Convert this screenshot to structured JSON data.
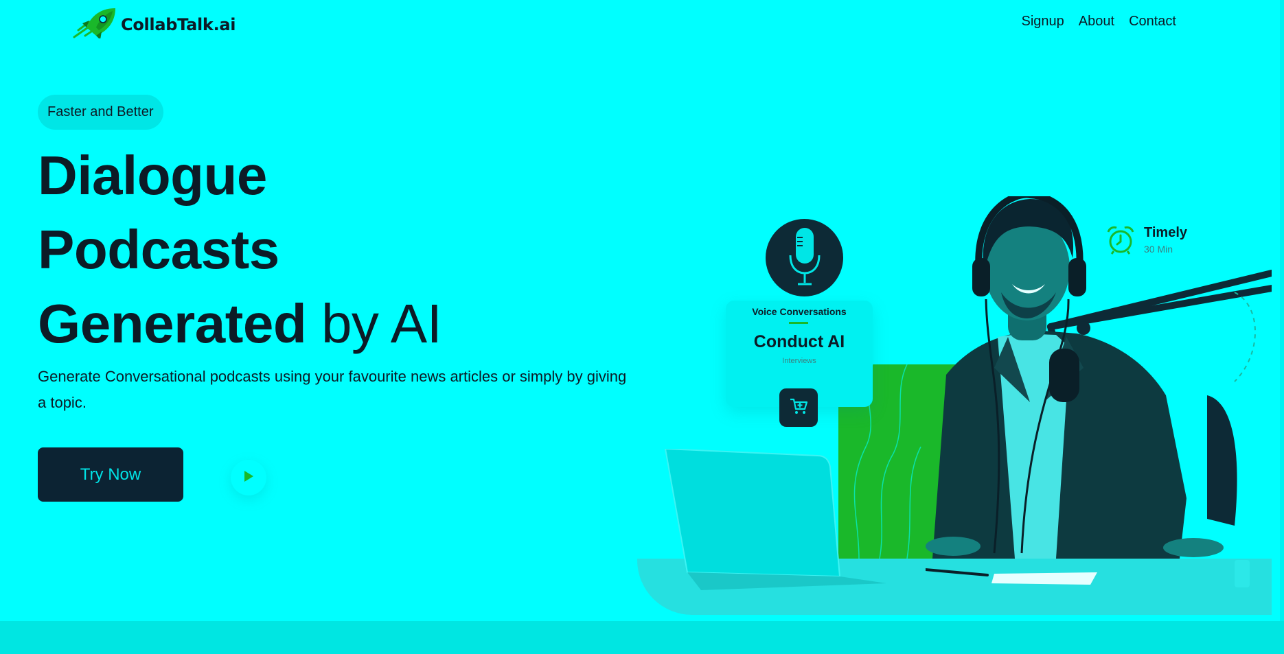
{
  "brand": {
    "name": "CollabTalk.ai",
    "logo_icon": "rocket-icon",
    "accent": "#1AB82A",
    "background": "#00FFFF",
    "dark": "#0C2333"
  },
  "nav": {
    "items": [
      "Signup",
      "About",
      "Contact"
    ]
  },
  "hero": {
    "badge": "Faster and Better",
    "headline_line1": "Dialogue",
    "headline_line2": "Podcasts",
    "headline_line3_bold": "Generated",
    "headline_line3_light": "by AI",
    "description": "Generate Conversational podcasts using your favourite news articles or simply by giving a topic.",
    "cta_label": "Try Now",
    "play_icon": "play-icon"
  },
  "illustration": {
    "card_title": "Voice Conversations",
    "card_headline": "Conduct AI",
    "card_subtitle": "Interviews",
    "mic_icon": "microphone-icon",
    "cart_icon": "cart-icon",
    "timely_title": "Timely",
    "timely_subtitle": "30 Min",
    "timely_icon": "alarm-clock-icon"
  }
}
